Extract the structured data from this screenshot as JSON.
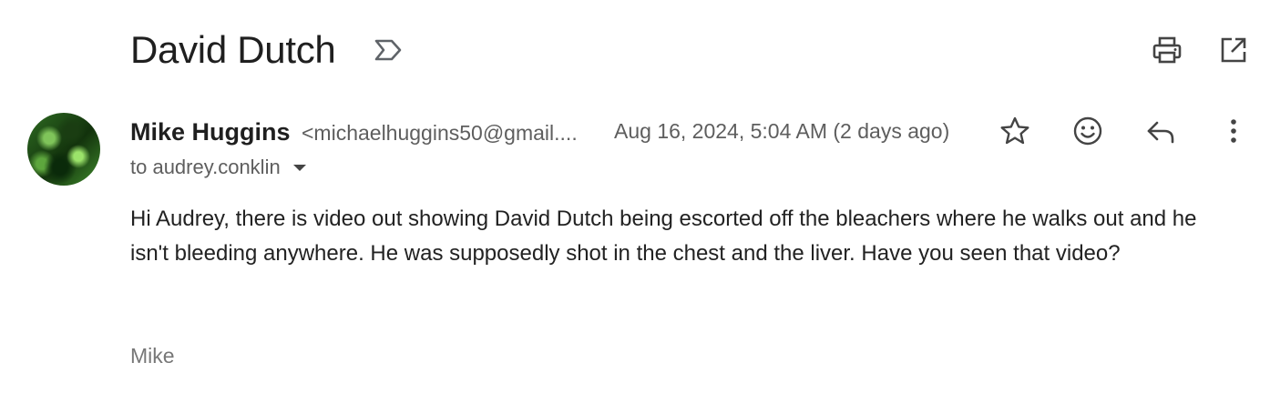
{
  "subject": "David Dutch",
  "icons": {
    "label": "important-label-icon",
    "print": "print-icon",
    "open_new_window": "open-in-new-window-icon",
    "star": "star-icon",
    "emoji": "emoji-reaction-icon",
    "reply": "reply-icon",
    "more": "more-vertical-icon"
  },
  "message": {
    "sender_name": "Mike Huggins",
    "sender_email": "<michaelhuggins50@gmail....",
    "date": "Aug 16, 2024, 5:04 AM (2 days ago)",
    "to": "to audrey.conklin",
    "body": "Hi Audrey, there is video out showing David Dutch being escorted off the bleachers where he walks out and he isn't bleeding anywhere. He was supposedly shot in the chest and the liver. Have you seen that video?",
    "signature": "Mike"
  },
  "colors": {
    "text_primary": "#1f1f1f",
    "text_secondary": "#5e5e5e",
    "signature": "#777777"
  }
}
